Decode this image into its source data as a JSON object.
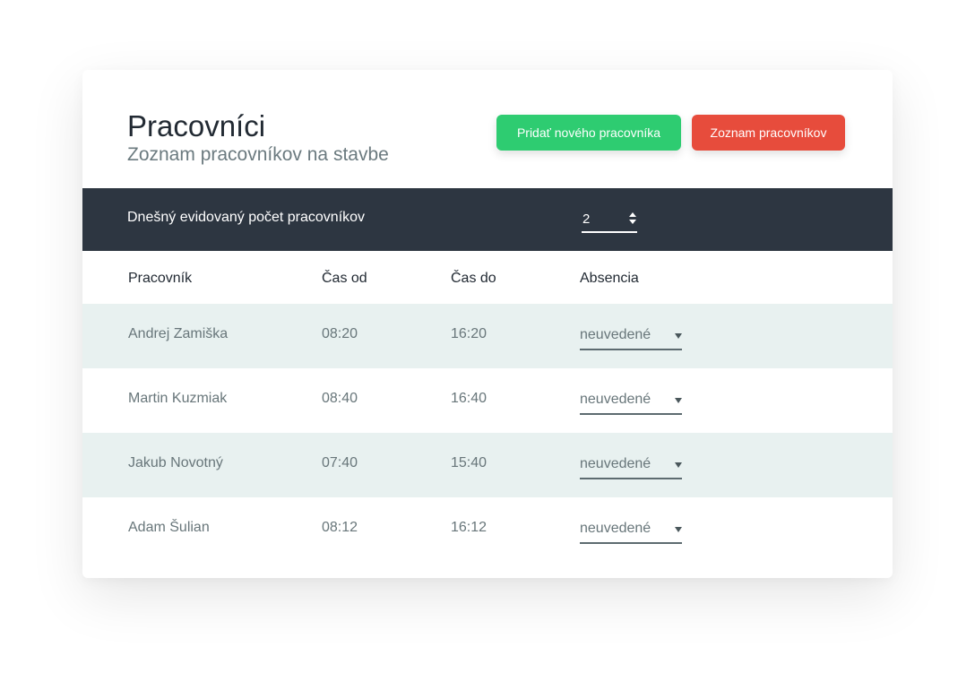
{
  "header": {
    "title": "Pracovníci",
    "subtitle": "Zoznam pracovníkov na stavbe",
    "add_button": "Pridať nového pracovníka",
    "list_button": "Zoznam pracovníkov"
  },
  "summary": {
    "label": "Dnešný evidovaný počet pracovníkov",
    "count": "2"
  },
  "table": {
    "columns": [
      "Pracovník",
      "Čas od",
      "Čas do",
      "Absencia"
    ],
    "rows": [
      {
        "name": "Andrej Zamiška",
        "from": "08:20",
        "to": "16:20",
        "absence": "neuvedené"
      },
      {
        "name": "Martin Kuzmiak",
        "from": "08:40",
        "to": "16:40",
        "absence": "neuvedené"
      },
      {
        "name": "Jakub Novotný",
        "from": "07:40",
        "to": "15:40",
        "absence": "neuvedené"
      },
      {
        "name": "Adam Šulian",
        "from": "08:12",
        "to": "16:12",
        "absence": "neuvedené"
      }
    ]
  },
  "colors": {
    "accent_green": "#2ecc71",
    "accent_red": "#e74c3c",
    "bar_dark": "#2d3641",
    "row_shade": "#e8f1f0"
  },
  "icons": {
    "stepper": "stepper-arrows-icon",
    "select": "chevron-down-icon"
  }
}
